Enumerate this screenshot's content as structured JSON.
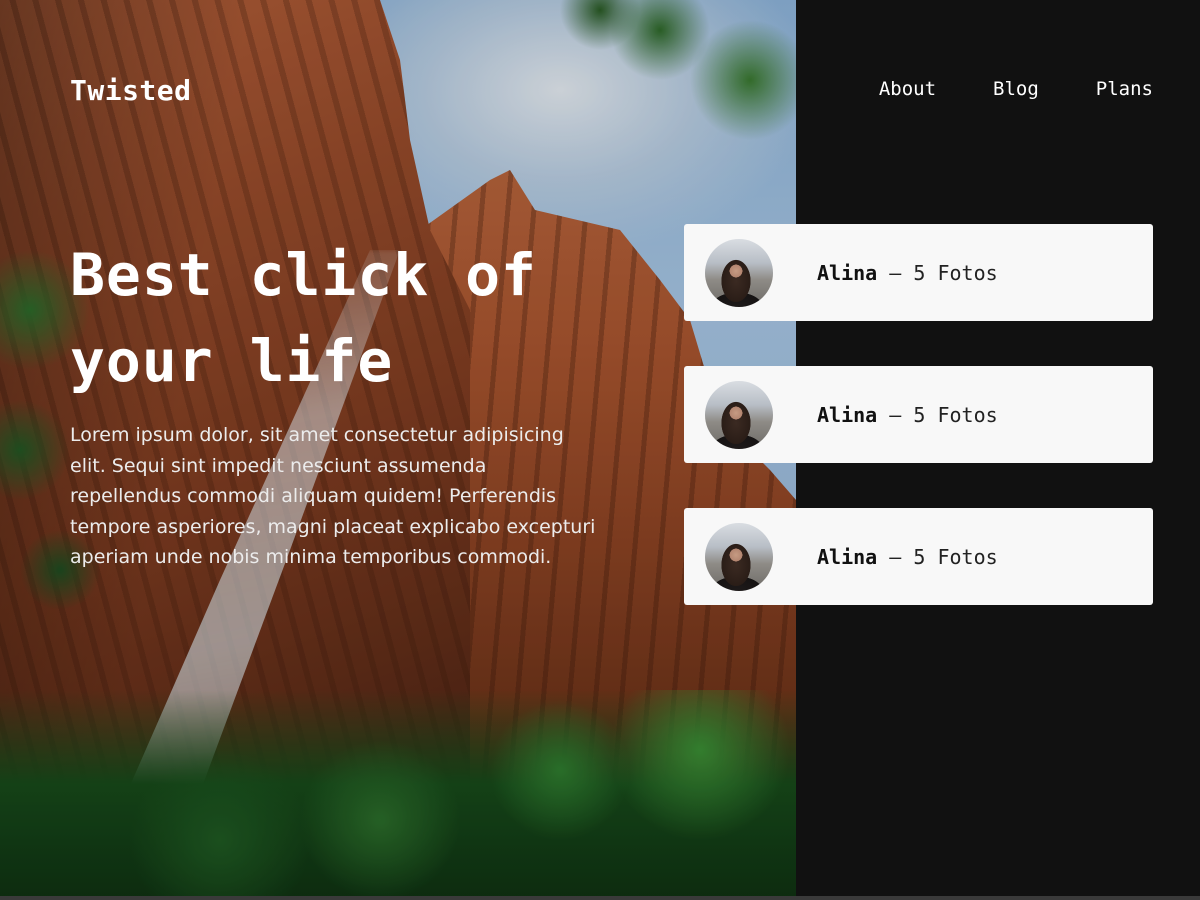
{
  "header": {
    "brand": "Twisted",
    "nav": [
      {
        "label": "About"
      },
      {
        "label": "Blog"
      },
      {
        "label": "Plans"
      }
    ]
  },
  "hero": {
    "headline": "Best click of your life",
    "lead": "Lorem ipsum dolor, sit amet consectetur adipisicing elit. Sequi sint impedit nesciunt assumenda repellendus commodi aliquam quidem! Perferendis tempore asperiores, magni placeat explicabo excepturi aperiam unde nobis minima temporibus commodi."
  },
  "cards": [
    {
      "name": "Alina",
      "separator": "—",
      "detail": "5 Fotos"
    },
    {
      "name": "Alina",
      "separator": "—",
      "detail": "5 Fotos"
    },
    {
      "name": "Alina",
      "separator": "—",
      "detail": "5 Fotos"
    }
  ],
  "colors": {
    "panel_bg": "#111111",
    "card_bg": "#f8f8f8",
    "text_light": "#ffffff"
  }
}
